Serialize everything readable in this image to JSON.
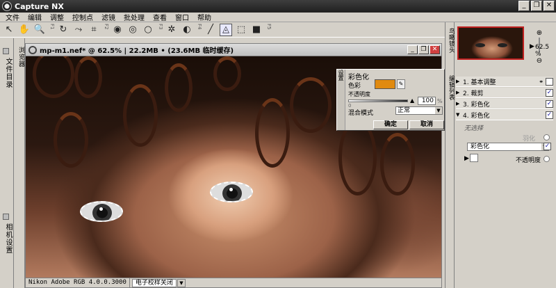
{
  "app": {
    "title": "Capture NX"
  },
  "window_controls": {
    "min": "_",
    "max": "❐",
    "close": "✕"
  },
  "menu": [
    "文件",
    "编辑",
    "调整",
    "控制点",
    "滤镜",
    "批处理",
    "查看",
    "窗口",
    "帮助"
  ],
  "left_tabs": {
    "browser": "浏览器",
    "file_dir": "文件目录",
    "camera_settings": "相机设置"
  },
  "document": {
    "title": "mp-m1.nef* @ 62.5% | 22.2MB • (23.6MB 临时缓存)",
    "status_profile": "Nikon Adobe RGB 4.0.0.3000",
    "status_proof": "电子校样关闭"
  },
  "dialog": {
    "side_label": "设置",
    "title": "彩色化",
    "color_label": "色彩",
    "opacity_label": "不透明度",
    "opacity_value": "100",
    "opacity_min": "0",
    "opacity_unit": "%",
    "blend_label": "混合模式",
    "blend_value": "正常",
    "ok": "确定",
    "cancel": "取消",
    "color": "#e08a10"
  },
  "right_tabs": {
    "birds_eye": "鸟瞰镜头",
    "edit_list": "编辑列表"
  },
  "navigator": {
    "zoom": "62.5 %"
  },
  "edit_list": {
    "steps": [
      {
        "label": "1. 基本调整",
        "checked": false
      },
      {
        "label": "2. 裁剪",
        "checked": true
      },
      {
        "label": "3. 彩色化",
        "checked": true
      },
      {
        "label": "4. 彩色化",
        "checked": true
      }
    ],
    "no_selection": "无选择",
    "feather": "羽化",
    "blend": "彩色化",
    "opacity": "不透明度"
  }
}
